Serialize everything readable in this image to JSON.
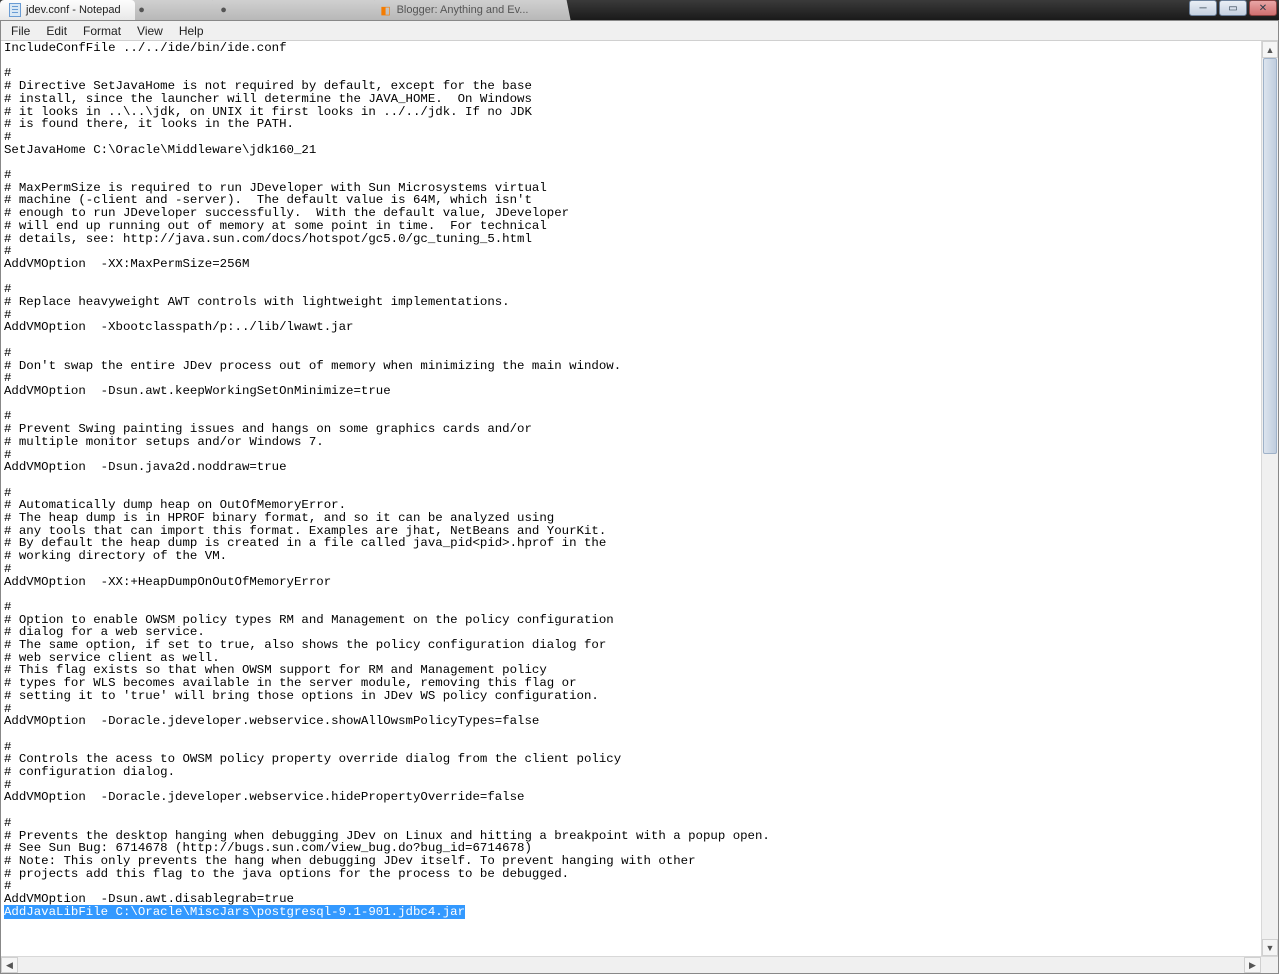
{
  "tabs": [
    {
      "label": "jdev.conf - Notepad",
      "active": true
    },
    {
      "label": "",
      "active": false
    },
    {
      "label": "",
      "active": false
    },
    {
      "label": "Blogger: Anything and Ev...",
      "active": false
    }
  ],
  "menubar": [
    "File",
    "Edit",
    "Format",
    "View",
    "Help"
  ],
  "editor": {
    "text_before_selection": "IncludeConfFile ../../ide/bin/ide.conf\n\n#\n# Directive SetJavaHome is not required by default, except for the base\n# install, since the launcher will determine the JAVA_HOME.  On Windows\n# it looks in ..\\..\\jdk, on UNIX it first looks in ../../jdk. If no JDK\n# is found there, it looks in the PATH.\n#\nSetJavaHome C:\\Oracle\\Middleware\\jdk160_21\n\n#\n# MaxPermSize is required to run JDeveloper with Sun Microsystems virtual\n# machine (-client and -server).  The default value is 64M, which isn't\n# enough to run JDeveloper successfully.  With the default value, JDeveloper\n# will end up running out of memory at some point in time.  For technical\n# details, see: http://java.sun.com/docs/hotspot/gc5.0/gc_tuning_5.html\n#\nAddVMOption  -XX:MaxPermSize=256M\n\n#\n# Replace heavyweight AWT controls with lightweight implementations.\n#\nAddVMOption  -Xbootclasspath/p:../lib/lwawt.jar\n\n#\n# Don't swap the entire JDev process out of memory when minimizing the main window.\n#\nAddVMOption  -Dsun.awt.keepWorkingSetOnMinimize=true\n\n#\n# Prevent Swing painting issues and hangs on some graphics cards and/or\n# multiple monitor setups and/or Windows 7.\n#\nAddVMOption  -Dsun.java2d.noddraw=true\n\n#\n# Automatically dump heap on OutOfMemoryError.\n# The heap dump is in HPROF binary format, and so it can be analyzed using\n# any tools that can import this format. Examples are jhat, NetBeans and YourKit.\n# By default the heap dump is created in a file called java_pid<pid>.hprof in the\n# working directory of the VM.\n#\nAddVMOption  -XX:+HeapDumpOnOutOfMemoryError\n\n#\n# Option to enable OWSM policy types RM and Management on the policy configuration\n# dialog for a web service.\n# The same option, if set to true, also shows the policy configuration dialog for\n# web service client as well.\n# This flag exists so that when OWSM support for RM and Management policy\n# types for WLS becomes available in the server module, removing this flag or\n# setting it to 'true' will bring those options in JDev WS policy configuration.\n#\nAddVMOption  -Doracle.jdeveloper.webservice.showAllOwsmPolicyTypes=false\n\n#\n# Controls the acess to OWSM policy property override dialog from the client policy\n# configuration dialog.\n#\nAddVMOption  -Doracle.jdeveloper.webservice.hidePropertyOverride=false\n\n#\n# Prevents the desktop hanging when debugging JDev on Linux and hitting a breakpoint with a popup open.\n# See Sun Bug: 6714678 (http://bugs.sun.com/view_bug.do?bug_id=6714678)\n# Note: This only prevents the hang when debugging JDev itself. To prevent hanging with other\n# projects add this flag to the java options for the process to be debugged.\n#\nAddVMOption  -Dsun.awt.disablegrab=true\n",
    "selected_text": "AddJavaLibFile C:\\Oracle\\MiscJars\\postgresql-9.1-901.jdbc4.jar"
  }
}
